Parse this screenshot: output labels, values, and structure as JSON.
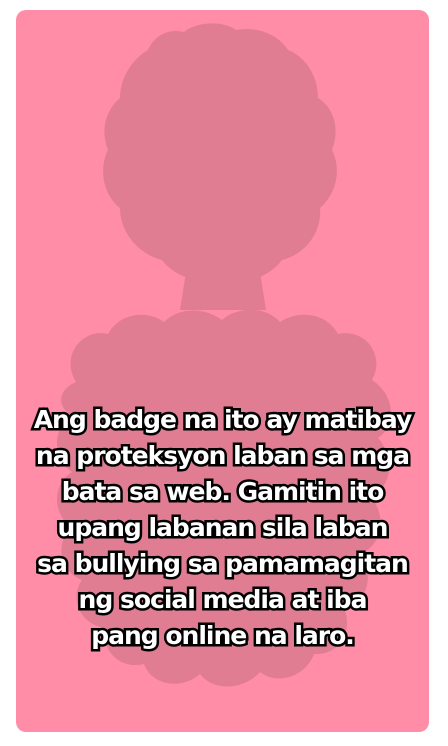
{
  "colors": {
    "page_background": "#ffffff",
    "card_background": "#ff8da8",
    "silhouette": "#e07d92",
    "text_fill": "#ffffff",
    "text_outline": "#000000"
  },
  "image": {
    "subject": "blurred-person-silhouette"
  },
  "caption": {
    "lines": [
      "Ang badge na ito ay matibay",
      "na proteksyon laban sa mga",
      "bata sa web. Gamitin ito",
      "upang labanan sila laban",
      "sa bullying sa pamamagitan",
      "ng social media at iba",
      "pang online na laro."
    ]
  }
}
